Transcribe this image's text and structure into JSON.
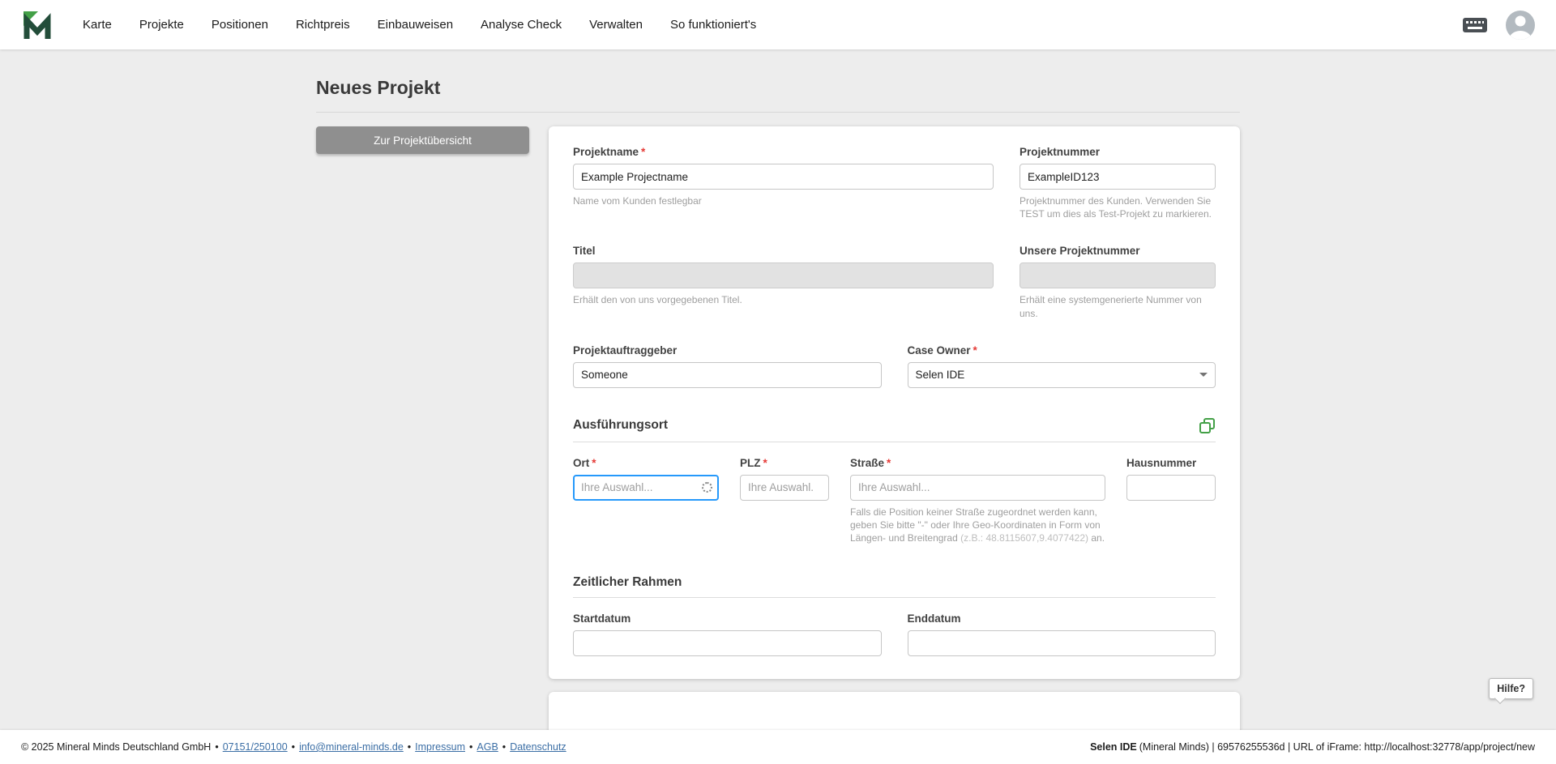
{
  "navbar": {
    "items": [
      {
        "label": "Karte"
      },
      {
        "label": "Projekte"
      },
      {
        "label": "Positionen"
      },
      {
        "label": "Richtpreis"
      },
      {
        "label": "Einbauweisen"
      },
      {
        "label": "Analyse Check"
      },
      {
        "label": "Verwalten"
      },
      {
        "label": "So funktioniert's"
      }
    ]
  },
  "page": {
    "title": "Neues Projekt",
    "back_button_label": "Zur Projektübersicht",
    "required_marker": "*"
  },
  "form": {
    "projektname": {
      "label": "Projektname",
      "value": "Example Projectname",
      "helper": "Name vom Kunden festlegbar"
    },
    "projektnummer": {
      "label": "Projektnummer",
      "value": "ExampleID123",
      "helper": "Projektnummer des Kunden. Verwenden Sie TEST um dies als Test-Projekt zu markieren."
    },
    "titel": {
      "label": "Titel",
      "value": "",
      "helper": "Erhält den von uns vorgegebenen Titel."
    },
    "unsere_projektnummer": {
      "label": "Unsere Projektnummer",
      "value": "",
      "helper": "Erhält eine systemgenerierte Nummer von uns."
    },
    "projektauftraggeber": {
      "label": "Projektauftraggeber",
      "value": "Someone"
    },
    "case_owner": {
      "label": "Case Owner",
      "value": "Selen IDE"
    },
    "sections": {
      "ausfuehrungsort": "Ausführungsort",
      "zeitlicher_rahmen": "Zeitlicher Rahmen"
    },
    "ort": {
      "label": "Ort",
      "placeholder": "Ihre Auswahl..."
    },
    "plz": {
      "label": "PLZ",
      "placeholder": "Ihre Auswahl."
    },
    "strasse": {
      "label": "Straße",
      "placeholder": "Ihre Auswahl...",
      "helper_main": "Falls die Position keiner Straße zugeordnet werden kann, geben Sie bitte \"-\" oder Ihre Geo-Koordinaten in Form von Längen- und Breitengrad ",
      "helper_example": "(z.B.: 48.8115607,9.4077422)",
      "helper_suffix": " an."
    },
    "hausnummer": {
      "label": "Hausnummer"
    },
    "startdatum": {
      "label": "Startdatum"
    },
    "enddatum": {
      "label": "Enddatum"
    }
  },
  "help_badge": "Hilfe?",
  "footer": {
    "copyright": "© 2025 Mineral Minds Deutschland GmbH",
    "separator": "•",
    "phone": "07151/250100",
    "email": "info@mineral-minds.de",
    "impressum": "Impressum",
    "agb": "AGB",
    "datenschutz": "Datenschutz",
    "user": "Selen IDE",
    "session_info": "(Mineral Minds) | 69576255536d | URL of iFrame: http://localhost:32778/app/project/new"
  },
  "colors": {
    "accent_green": "#43a047",
    "focus_blue": "#2699fb",
    "required_red": "#e53935",
    "link_blue": "#3b6ea5"
  }
}
